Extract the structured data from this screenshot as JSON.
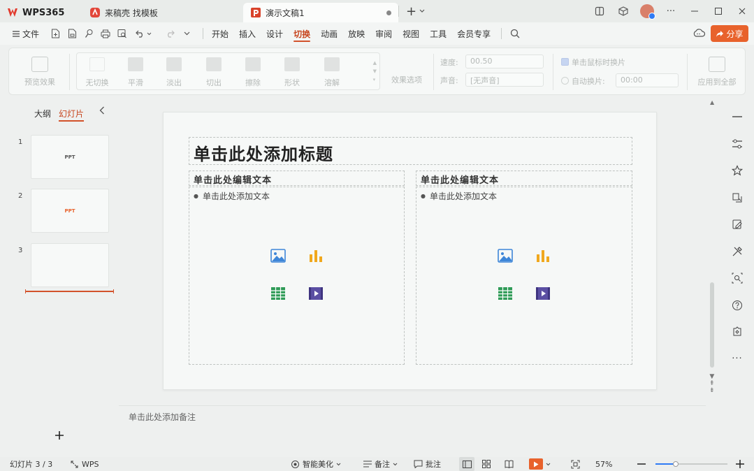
{
  "titlebar": {
    "tabs": [
      {
        "label": "WPS365",
        "icon": "wps-logo-icon"
      },
      {
        "label": "来稿壳 找模板",
        "icon": "docer-icon"
      },
      {
        "label": "演示文稿1",
        "icon": "presentation-icon",
        "active": true
      }
    ]
  },
  "menubar": {
    "file_label": "文件",
    "tabs": [
      "开始",
      "插入",
      "设计",
      "切换",
      "动画",
      "放映",
      "审阅",
      "视图",
      "工具",
      "会员专享"
    ],
    "active_tab": "切换",
    "share_label": "分享"
  },
  "ribbon": {
    "preview_label": "预览效果",
    "transitions": [
      "无切换",
      "平滑",
      "淡出",
      "切出",
      "擦除",
      "形状",
      "溶解"
    ],
    "effect_options_label": "效果选项",
    "speed_label": "速度:",
    "speed_value": "00.50",
    "sound_label": "声音:",
    "sound_value": "[无声音]",
    "click_advance_label": "单击鼠标时换片",
    "auto_advance_label": "自动换片:",
    "auto_advance_value": "00:00",
    "apply_all_label": "应用到全部"
  },
  "leftpanel": {
    "outline_tab": "大纲",
    "slides_tab": "幻灯片",
    "thumbnails": [
      {
        "num": "1",
        "text": "PPT"
      },
      {
        "num": "2",
        "text": "PPT"
      },
      {
        "num": "3",
        "text": ""
      }
    ]
  },
  "slide": {
    "title_placeholder": "单击此处添加标题",
    "left_subtitle": "单击此处编辑文本",
    "left_body": "单击此处添加文本",
    "right_subtitle": "单击此处编辑文本",
    "right_body": "单击此处添加文本"
  },
  "notes_placeholder": "单击此处添加备注",
  "statusbar": {
    "slide_counter": "幻灯片 3 / 3",
    "wps_label": "WPS",
    "smart_beautify": "智能美化",
    "notes_label": "备注",
    "comments_label": "批注",
    "zoom": "57%",
    "zoom_fraction": 0.28
  },
  "colors": {
    "accent": "#d2522b",
    "share": "#e8622c",
    "blue": "#2f7bf5"
  }
}
